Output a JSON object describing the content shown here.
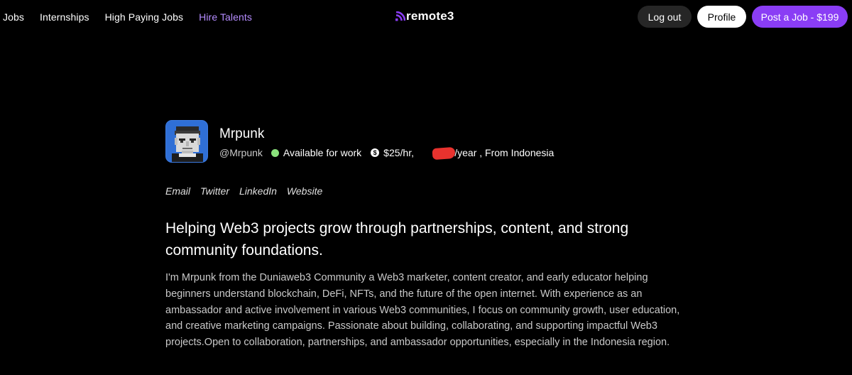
{
  "nav": {
    "items": [
      "Jobs",
      "Internships",
      "High Paying Jobs",
      "Hire Talents"
    ]
  },
  "logo": {
    "text": "remote3",
    "icon": "signal-icon",
    "icon_color": "#8a3df5"
  },
  "header_buttons": {
    "logout": "Log out",
    "profile": "Profile",
    "post_job": "Post a Job - $199"
  },
  "colors": {
    "accent": "#8a3df5",
    "hire_link": "#b58cff",
    "available": "#8be27c",
    "redaction": "#e8322e"
  },
  "profile": {
    "name": "Mrpunk",
    "handle": "@Mrpunk",
    "status": "Available for work",
    "rate_prefix": "$25/hr,",
    "rate_suffix": ".000/year , From Indonesia",
    "links": [
      "Email",
      "Twitter",
      "LinkedIn",
      "Website"
    ],
    "headline": "Helping Web3 projects grow through partnerships, content, and strong community foundations.",
    "bio": "I'm Mrpunk from the Duniaweb3 Community a Web3 marketer, content creator, and early educator helping beginners understand blockchain, DeFi, NFTs, and the future of the open internet. With experience as an ambassador and active involvement in various Web3 communities, I focus on community growth, user education, and creative marketing campaigns. Passionate about building, collaborating, and supporting impactful Web3 projects.Open to collaboration, partnerships, and ambassador opportunities, especially in the Indonesia region."
  }
}
